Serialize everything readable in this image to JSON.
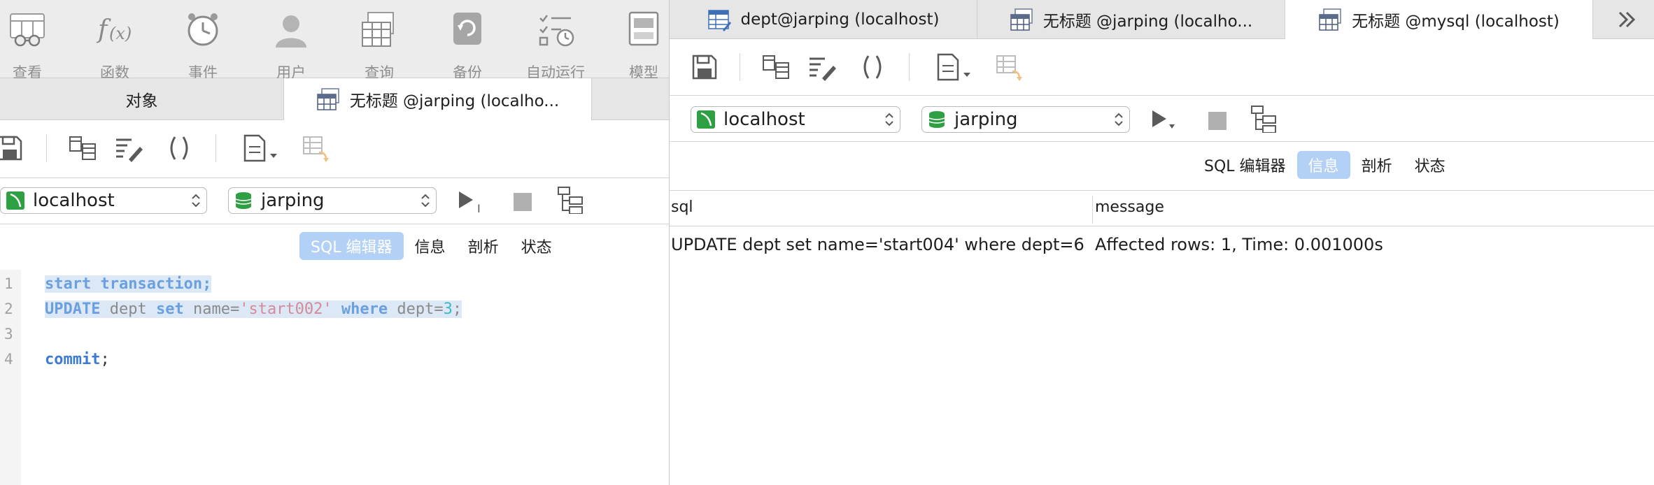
{
  "main_toolbar": {
    "items": [
      {
        "label": "查看",
        "icon": "view-icon"
      },
      {
        "label": "函数",
        "icon": "function-icon"
      },
      {
        "label": "事件",
        "icon": "event-clock-icon"
      },
      {
        "label": "用户",
        "icon": "user-icon"
      },
      {
        "label": "查询",
        "icon": "query-table-icon"
      },
      {
        "label": "备份",
        "icon": "backup-icon"
      },
      {
        "label": "自动运行",
        "icon": "automation-checklist-icon"
      },
      {
        "label": "模型",
        "icon": "model-icon"
      }
    ]
  },
  "left_tabs": {
    "objects": "对象",
    "active": "无标题 @jarping (localho..."
  },
  "left_editor": {
    "connection": "localhost",
    "database": "jarping",
    "segments": [
      "SQL 编辑器",
      "信息",
      "剖析",
      "状态"
    ],
    "active_segment": "SQL 编辑器",
    "line_numbers": [
      "1",
      "2",
      "3",
      "4"
    ],
    "code": {
      "l1_kw": "start transaction",
      "l1_end": ";",
      "l2_update": "UPDATE",
      "l2_dept": " dept ",
      "l2_set": "set",
      "l2_name": " name=",
      "l2_str": "'start002'",
      "l2_sp": " ",
      "l2_where": "where",
      "l2_deptvar": " dept=",
      "l2_num": "3",
      "l2_end": ";",
      "l4_commit": "commit",
      "l4_end": ";"
    }
  },
  "right_tabs": [
    {
      "label": "dept@jarping (localhost)",
      "icon": "table-edit-icon"
    },
    {
      "label": "无标题 @jarping (localho...",
      "icon": "query-table-icon"
    },
    {
      "label": "无标题 @mysql (localhost)",
      "icon": "query-table-icon",
      "active": true
    }
  ],
  "right_editor": {
    "connection": "localhost",
    "database": "jarping",
    "segments": [
      "SQL 编辑器",
      "信息",
      "剖析",
      "状态"
    ],
    "active_segment": "信息",
    "table": {
      "columns": [
        "sql",
        "message"
      ],
      "rows": [
        {
          "sql": "UPDATE dept set name='start004' where dept=6",
          "message": "Affected rows: 1, Time: 0.001000s"
        }
      ]
    }
  },
  "colors": {
    "accent": "#b3d1f6",
    "connection_green": "#2ea043",
    "toolbar_bg": "#ececec"
  }
}
